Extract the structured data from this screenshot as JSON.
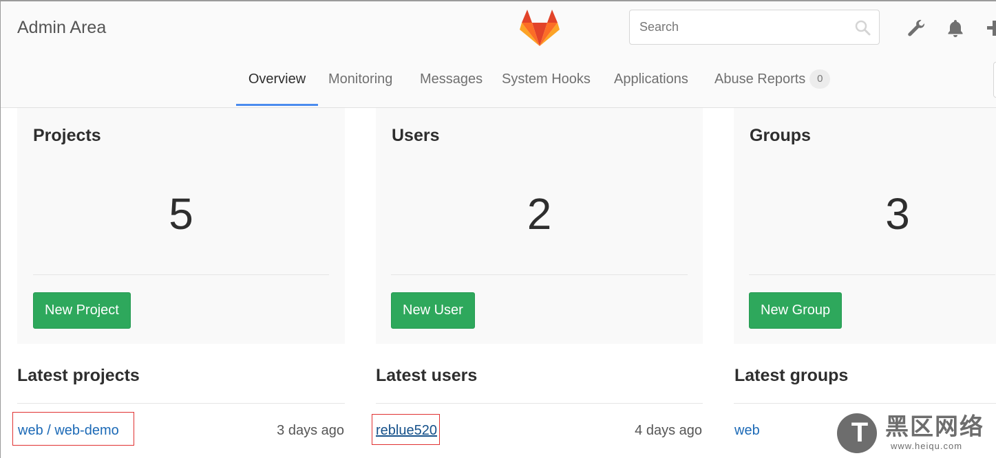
{
  "header": {
    "title": "Admin Area",
    "search": {
      "placeholder": "Search",
      "value": ""
    },
    "icons": [
      "gitlab-logo",
      "wrench-icon",
      "bell-icon",
      "plus-icon"
    ]
  },
  "tabs": [
    {
      "label": "Overview",
      "active": true
    },
    {
      "label": "Monitoring",
      "active": false
    },
    {
      "label": "Messages",
      "active": false
    },
    {
      "label": "System Hooks",
      "active": false
    },
    {
      "label": "Applications",
      "active": false
    },
    {
      "label": "Abuse Reports",
      "active": false,
      "badge": "0"
    }
  ],
  "stats": [
    {
      "title": "Projects",
      "count": "5",
      "button": "New Project"
    },
    {
      "title": "Users",
      "count": "2",
      "button": "New User"
    },
    {
      "title": "Groups",
      "count": "3",
      "button": "New Group"
    }
  ],
  "latest": {
    "projects": {
      "title": "Latest projects",
      "items": [
        {
          "name": "web / web-demo",
          "time": "3 days ago"
        }
      ]
    },
    "users": {
      "title": "Latest users",
      "items": [
        {
          "name": "reblue520",
          "time": "4 days ago"
        }
      ]
    },
    "groups": {
      "title": "Latest groups",
      "items": [
        {
          "name": "web"
        }
      ]
    }
  },
  "watermark": {
    "letter": "T",
    "text": "黑区网络",
    "url": "www.heiqu.com"
  },
  "colors": {
    "accent": "#4a8bee",
    "button_green": "#2ea85c",
    "link_blue": "#1b69b6",
    "highlight_red": "#e03030"
  }
}
